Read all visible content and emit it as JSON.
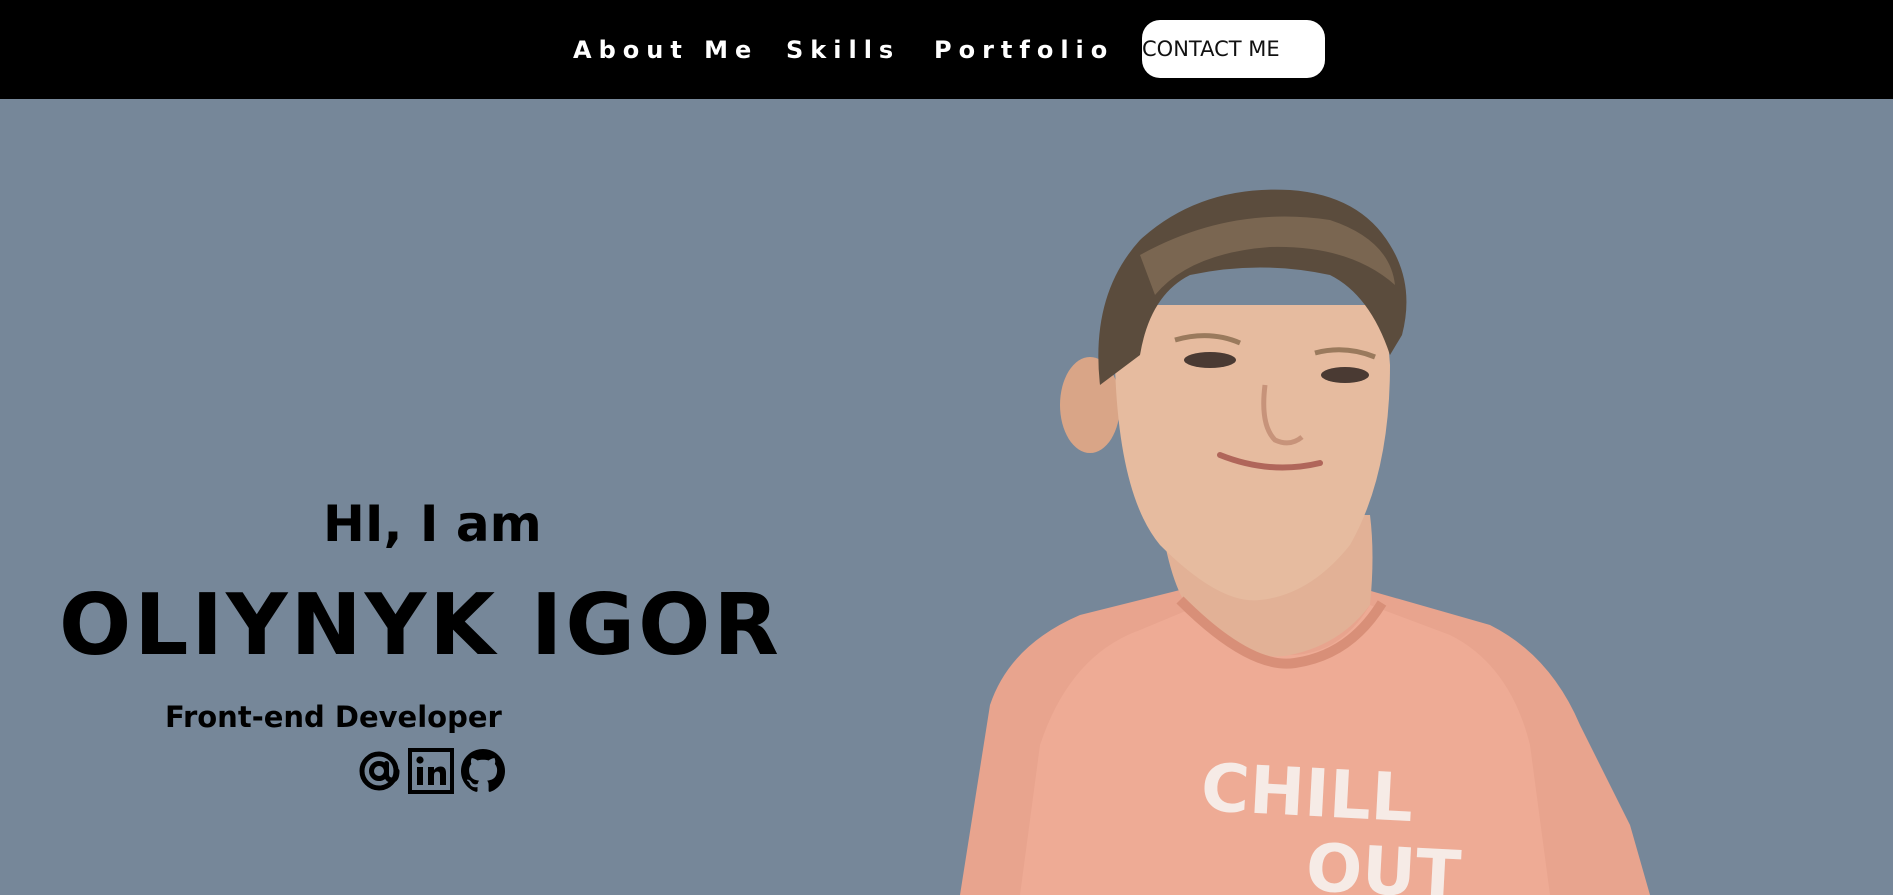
{
  "nav": {
    "links": [
      "About Me",
      "Skills",
      "Portfolio"
    ],
    "contact_label": "CONTACT ME"
  },
  "hero": {
    "greeting": "HI, I am",
    "name": "OLIYNYK IGOR",
    "role": "Front-end Developer",
    "socials": [
      "email-icon",
      "linkedin-icon",
      "github-icon"
    ],
    "shirt_text_line1": "CHILL",
    "shirt_text_line2": "OUT"
  },
  "colors": {
    "header_bg": "#000000",
    "page_bg": "#768799",
    "shirt": "#e8a48e"
  }
}
